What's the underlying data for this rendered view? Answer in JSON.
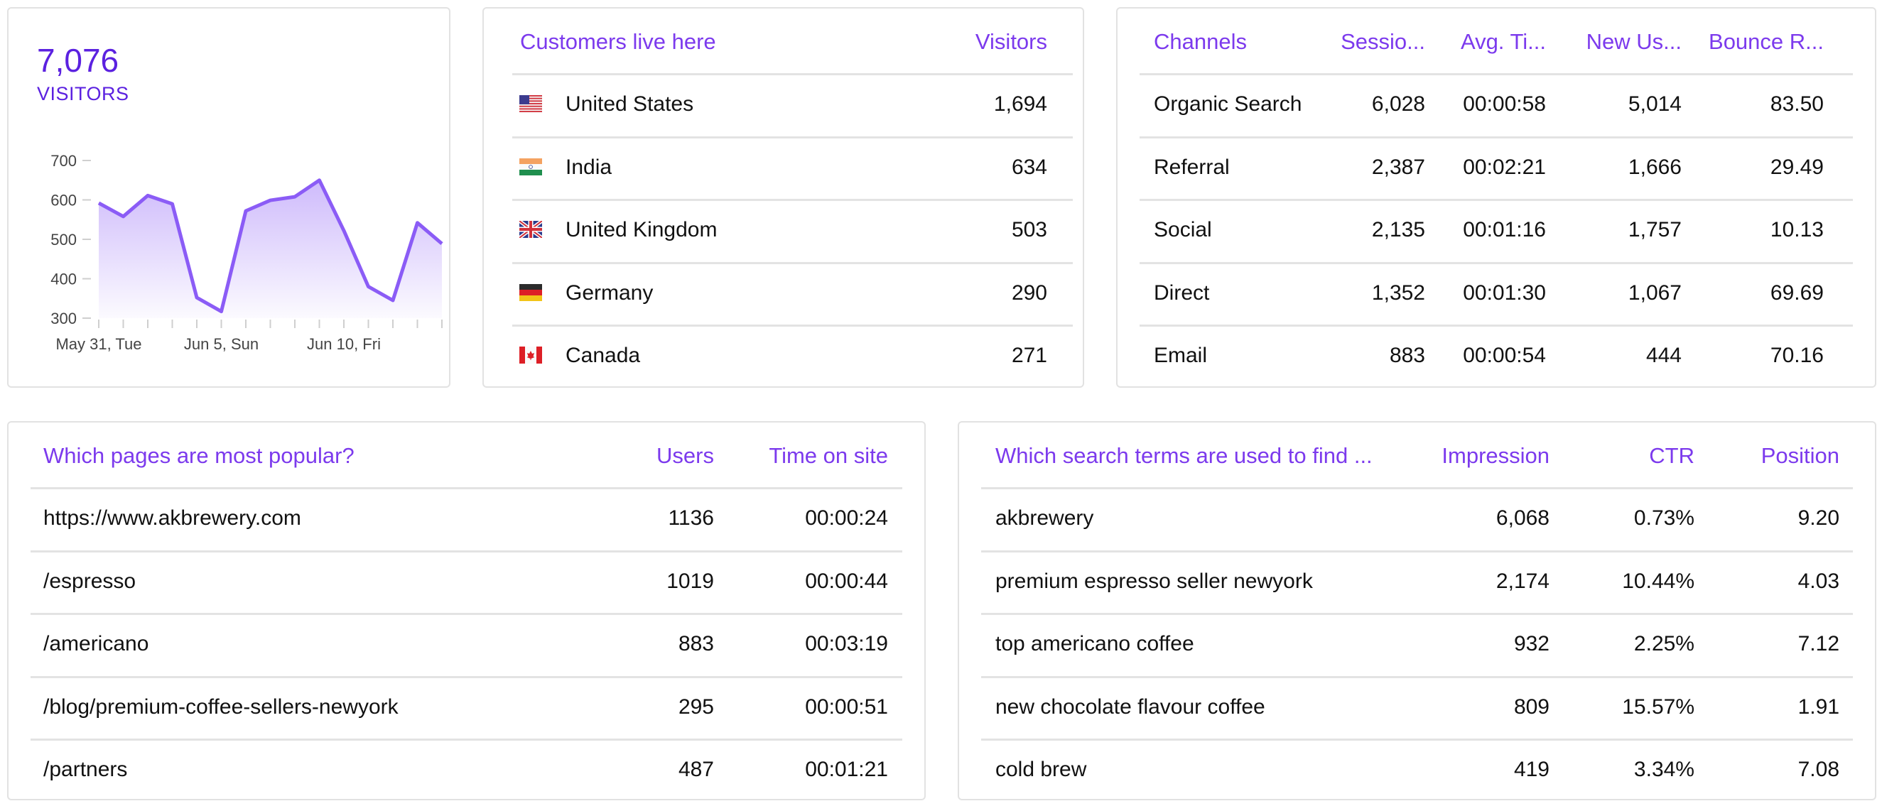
{
  "visitors_card": {
    "total": "7,076",
    "label": "VISITORS",
    "accent_color": "#8b5cf6"
  },
  "chart_data": {
    "type": "area",
    "title": "",
    "xlabel": "",
    "ylabel": "",
    "x": [
      "May 31",
      "Jun 1",
      "Jun 2",
      "Jun 3",
      "Jun 4",
      "Jun 5",
      "Jun 6",
      "Jun 7",
      "Jun 8",
      "Jun 9",
      "Jun 10",
      "Jun 11",
      "Jun 12",
      "Jun 13",
      "Jun 14"
    ],
    "values": [
      592,
      558,
      611,
      590,
      352,
      317,
      572,
      599,
      608,
      650,
      522,
      380,
      345,
      542,
      489
    ],
    "ylim": [
      300,
      700
    ],
    "yticks": [
      700,
      600,
      500,
      400,
      300
    ],
    "xtick_labels": [
      {
        "index": 0,
        "label": "May 31, Tue"
      },
      {
        "index": 5,
        "label": "Jun 5, Sun"
      },
      {
        "index": 10,
        "label": "Jun 10, Fri"
      }
    ],
    "grid": false,
    "legend": "none",
    "line_color": "#8b5cf6"
  },
  "countries": {
    "header": {
      "name": "Customers live here",
      "visitors": "Visitors"
    },
    "rows": [
      {
        "flag": "us-flag",
        "name": "United States",
        "visitors": "1,694"
      },
      {
        "flag": "in-flag",
        "name": "India",
        "visitors": "634"
      },
      {
        "flag": "gb-flag",
        "name": "United Kingdom",
        "visitors": "503"
      },
      {
        "flag": "de-flag",
        "name": "Germany",
        "visitors": "290"
      },
      {
        "flag": "ca-flag",
        "name": "Canada",
        "visitors": "271"
      }
    ]
  },
  "channels": {
    "header": {
      "name": "Channels",
      "sessions": "Sessio...",
      "avg_time": "Avg. Ti...",
      "new_users": "New Us...",
      "bounce": "Bounce R..."
    },
    "rows": [
      {
        "name": "Organic Search",
        "sessions": "6,028",
        "avg_time": "00:00:58",
        "new_users": "5,014",
        "bounce": "83.50"
      },
      {
        "name": "Referral",
        "sessions": "2,387",
        "avg_time": "00:02:21",
        "new_users": "1,666",
        "bounce": "29.49"
      },
      {
        "name": "Social",
        "sessions": "2,135",
        "avg_time": "00:01:16",
        "new_users": "1,757",
        "bounce": "10.13"
      },
      {
        "name": "Direct",
        "sessions": "1,352",
        "avg_time": "00:01:30",
        "new_users": "1,067",
        "bounce": "69.69"
      },
      {
        "name": "Email",
        "sessions": "883",
        "avg_time": "00:00:54",
        "new_users": "444",
        "bounce": "70.16"
      }
    ]
  },
  "pages": {
    "header": {
      "name": "Which pages are most popular?",
      "users": "Users",
      "time": "Time on site"
    },
    "rows": [
      {
        "name": "https://www.akbrewery.com",
        "users": "1136",
        "time": "00:00:24"
      },
      {
        "name": "/espresso",
        "users": "1019",
        "time": "00:00:44"
      },
      {
        "name": "/americano",
        "users": "883",
        "time": "00:03:19"
      },
      {
        "name": "/blog/premium-coffee-sellers-newyork",
        "users": "295",
        "time": "00:00:51"
      },
      {
        "name": "/partners",
        "users": "487",
        "time": "00:01:21"
      }
    ]
  },
  "search_terms": {
    "header": {
      "name": "Which search terms are used to find ...",
      "impression": "Impression",
      "ctr": "CTR",
      "position": "Position"
    },
    "rows": [
      {
        "name": "akbrewery",
        "impression": "6,068",
        "ctr": "0.73%",
        "position": "9.20"
      },
      {
        "name": "premium espresso seller newyork",
        "impression": "2,174",
        "ctr": "10.44%",
        "position": "4.03"
      },
      {
        "name": "top americano coffee",
        "impression": "932",
        "ctr": "2.25%",
        "position": "7.12"
      },
      {
        "name": "new chocolate flavour coffee",
        "impression": "809",
        "ctr": "15.57%",
        "position": "1.91"
      },
      {
        "name": "cold brew",
        "impression": "419",
        "ctr": "3.34%",
        "position": "7.08"
      }
    ]
  }
}
